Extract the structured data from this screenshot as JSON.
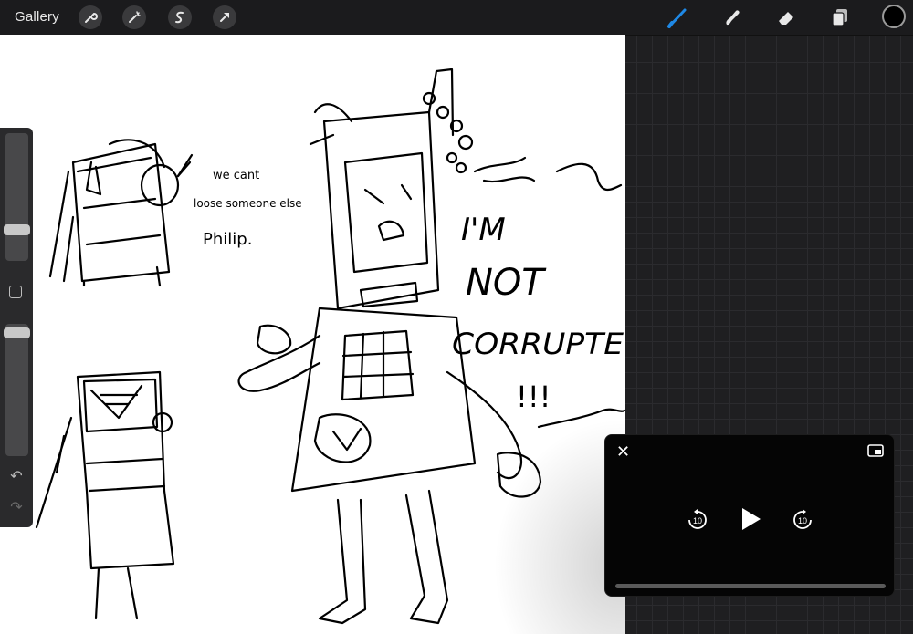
{
  "topbar": {
    "gallery_label": "Gallery",
    "left_tools": [
      "wrench-icon",
      "magic-wand-icon",
      "selection-icon",
      "transform-arrow-icon"
    ],
    "right_tools": [
      "brush-icon",
      "smudge-icon",
      "eraser-icon",
      "layers-icon"
    ],
    "current_color": "#000000",
    "active_color": "#1e88e5"
  },
  "sidebar": {
    "brush_size_label": "brush-size-slider",
    "opacity_label": "opacity-slider",
    "undo_icon": "undo-icon",
    "redo_icon": "redo-icon"
  },
  "canvas": {
    "handwriting_line1": "we cant",
    "handwriting_line2": "loose someone else",
    "handwriting_line3": "Philip.",
    "shout_line1": "I'M",
    "shout_line2": "NOT",
    "shout_line3": "CORRUPTE",
    "shout_line4": "!!!"
  },
  "video_player": {
    "close_icon": "close-icon",
    "pip_icon": "picture-in-picture-icon",
    "skip_back_label": "10",
    "skip_forward_label": "10",
    "play_icon": "play-icon",
    "progress": 0
  }
}
